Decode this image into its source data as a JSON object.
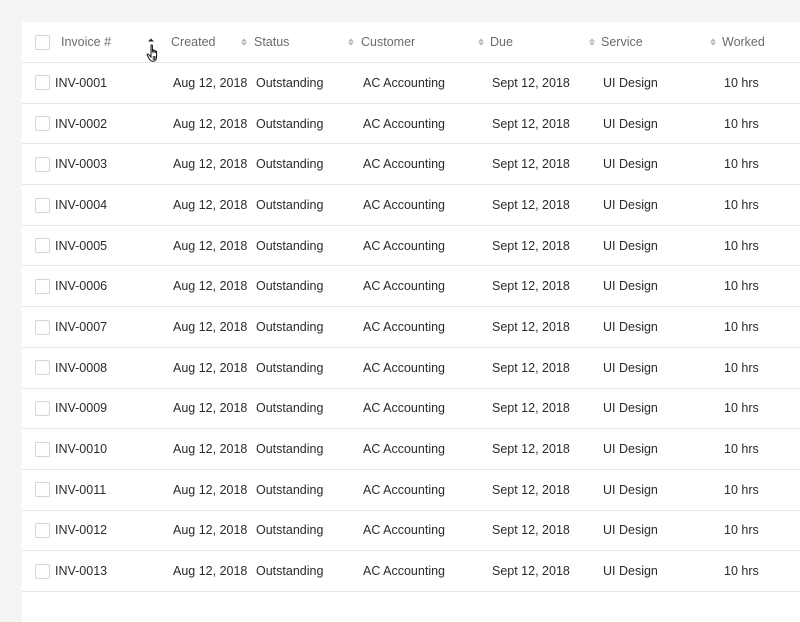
{
  "table": {
    "columns": [
      {
        "key": "invoice",
        "label": "Invoice #",
        "sort": "asc"
      },
      {
        "key": "created",
        "label": "Created",
        "sort": "none"
      },
      {
        "key": "status",
        "label": "Status",
        "sort": "none"
      },
      {
        "key": "customer",
        "label": "Customer",
        "sort": "none"
      },
      {
        "key": "due",
        "label": "Due",
        "sort": "none"
      },
      {
        "key": "service",
        "label": "Service",
        "sort": "none"
      },
      {
        "key": "worked",
        "label": "Worked",
        "sort": "none"
      }
    ],
    "rows": [
      {
        "invoice": "INV-0001",
        "created": "Aug 12, 2018",
        "status": "Outstanding",
        "customer": "AC Accounting",
        "due": "Sept 12, 2018",
        "service": "UI Design",
        "worked": "10 hrs"
      },
      {
        "invoice": "INV-0002",
        "created": "Aug 12, 2018",
        "status": "Outstanding",
        "customer": "AC Accounting",
        "due": "Sept 12, 2018",
        "service": "UI Design",
        "worked": "10 hrs"
      },
      {
        "invoice": "INV-0003",
        "created": "Aug 12, 2018",
        "status": "Outstanding",
        "customer": "AC Accounting",
        "due": "Sept 12, 2018",
        "service": "UI Design",
        "worked": "10 hrs"
      },
      {
        "invoice": "INV-0004",
        "created": "Aug 12, 2018",
        "status": "Outstanding",
        "customer": "AC Accounting",
        "due": "Sept 12, 2018",
        "service": "UI Design",
        "worked": "10 hrs"
      },
      {
        "invoice": "INV-0005",
        "created": "Aug 12, 2018",
        "status": "Outstanding",
        "customer": "AC Accounting",
        "due": "Sept 12, 2018",
        "service": "UI Design",
        "worked": "10 hrs"
      },
      {
        "invoice": "INV-0006",
        "created": "Aug 12, 2018",
        "status": "Outstanding",
        "customer": "AC Accounting",
        "due": "Sept 12, 2018",
        "service": "UI Design",
        "worked": "10 hrs"
      },
      {
        "invoice": "INV-0007",
        "created": "Aug 12, 2018",
        "status": "Outstanding",
        "customer": "AC Accounting",
        "due": "Sept 12, 2018",
        "service": "UI Design",
        "worked": "10 hrs"
      },
      {
        "invoice": "INV-0008",
        "created": "Aug 12, 2018",
        "status": "Outstanding",
        "customer": "AC Accounting",
        "due": "Sept 12, 2018",
        "service": "UI Design",
        "worked": "10 hrs"
      },
      {
        "invoice": "INV-0009",
        "created": "Aug 12, 2018",
        "status": "Outstanding",
        "customer": "AC Accounting",
        "due": "Sept 12, 2018",
        "service": "UI Design",
        "worked": "10 hrs"
      },
      {
        "invoice": "INV-0010",
        "created": "Aug 12, 2018",
        "status": "Outstanding",
        "customer": "AC Accounting",
        "due": "Sept 12, 2018",
        "service": "UI Design",
        "worked": "10 hrs"
      },
      {
        "invoice": "INV-0011",
        "created": "Aug 12, 2018",
        "status": "Outstanding",
        "customer": "AC Accounting",
        "due": "Sept 12, 2018",
        "service": "UI Design",
        "worked": "10 hrs"
      },
      {
        "invoice": "INV-0012",
        "created": "Aug 12, 2018",
        "status": "Outstanding",
        "customer": "AC Accounting",
        "due": "Sept 12, 2018",
        "service": "UI Design",
        "worked": "10 hrs"
      },
      {
        "invoice": "INV-0013",
        "created": "Aug 12, 2018",
        "status": "Outstanding",
        "customer": "AC Accounting",
        "due": "Sept 12, 2018",
        "service": "UI Design",
        "worked": "10 hrs"
      }
    ]
  },
  "icons": {
    "sort_asc": "sort-ascending-icon",
    "sort_both": "sort-icon",
    "cursor": "hand-pointer-cursor"
  }
}
